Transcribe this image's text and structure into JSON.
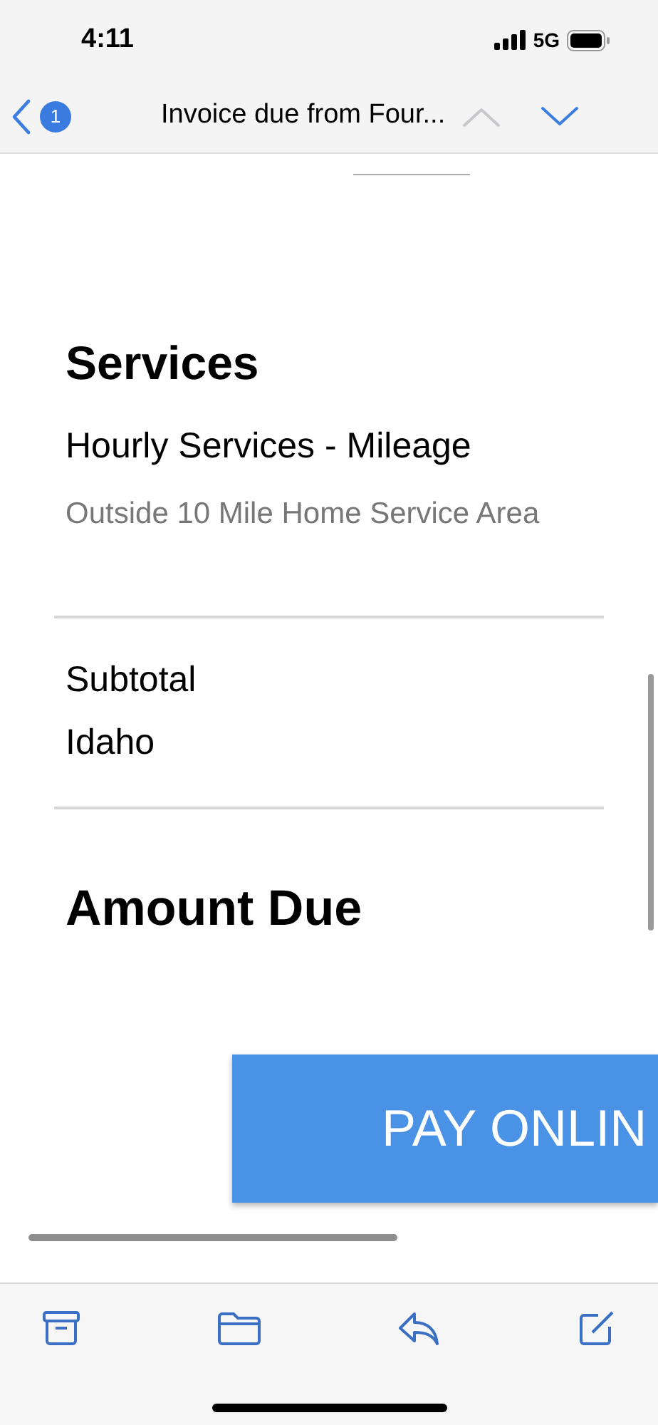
{
  "status_bar": {
    "time": "4:11",
    "network": "5G"
  },
  "nav": {
    "unread_count": "1",
    "title": "Invoice due from Four...",
    "previous": {
      "disabled": true
    },
    "next": {
      "disabled": false
    }
  },
  "services": {
    "heading": "Services",
    "item": "Hourly Services - Mileage",
    "description": "Outside 10 Mile Home Service Area"
  },
  "totals": [
    "Subtotal",
    "Idaho"
  ],
  "amount_due": {
    "heading": "Amount Due"
  },
  "pay_button": {
    "label": "PAY ONLIN"
  }
}
